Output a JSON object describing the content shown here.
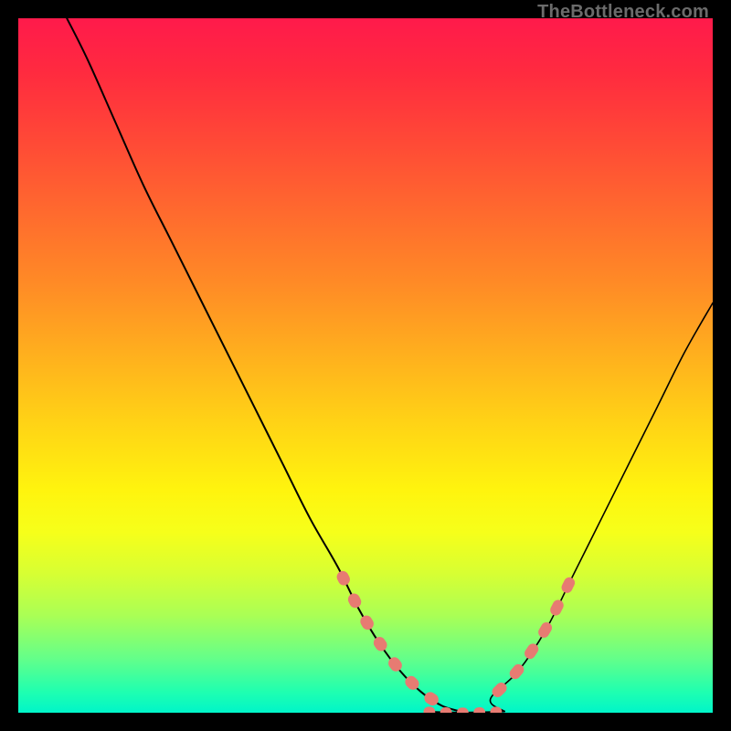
{
  "watermark": "TheBottleneck.com",
  "colors": {
    "background": "#000000",
    "gradient_top": "#ff1a4b",
    "gradient_bottom": "#00f5c9",
    "curve": "#000000",
    "marker": "#e77b72"
  },
  "chart_data": {
    "type": "line",
    "title": "",
    "xlabel": "",
    "ylabel": "",
    "xlim": [
      0,
      100
    ],
    "ylim": [
      0,
      100
    ],
    "grid": false,
    "legend": false,
    "notes": "V-shaped curve over rainbow gradient; axes hidden; coral segment markers on lower portions of each arm near the trough.",
    "series": [
      {
        "name": "left-arm",
        "x": [
          7,
          10,
          14,
          18,
          22,
          26,
          30,
          34,
          38,
          42,
          46,
          49,
          52,
          55,
          58,
          61,
          64
        ],
        "y": [
          100,
          94,
          85,
          76,
          68,
          60,
          52,
          44,
          36,
          28,
          21,
          15,
          10,
          6,
          3,
          1,
          0
        ]
      },
      {
        "name": "trough",
        "x": [
          58,
          60,
          62,
          64,
          66,
          68,
          70
        ],
        "y": [
          0.2,
          0.1,
          0.05,
          0,
          0.05,
          0.1,
          0.2
        ]
      },
      {
        "name": "right-arm",
        "x": [
          64,
          68,
          72,
          76,
          80,
          84,
          88,
          92,
          96,
          100
        ],
        "y": [
          0,
          2,
          6,
          12,
          20,
          28,
          36,
          44,
          52,
          59
        ]
      }
    ],
    "markers": {
      "description": "coral rounded segments overlaid on lower arms",
      "left_arm_y_range": [
        0.5,
        24
      ],
      "right_arm_y_range": [
        0.5,
        24
      ],
      "trough_fill_y_range": [
        0,
        1
      ]
    }
  }
}
